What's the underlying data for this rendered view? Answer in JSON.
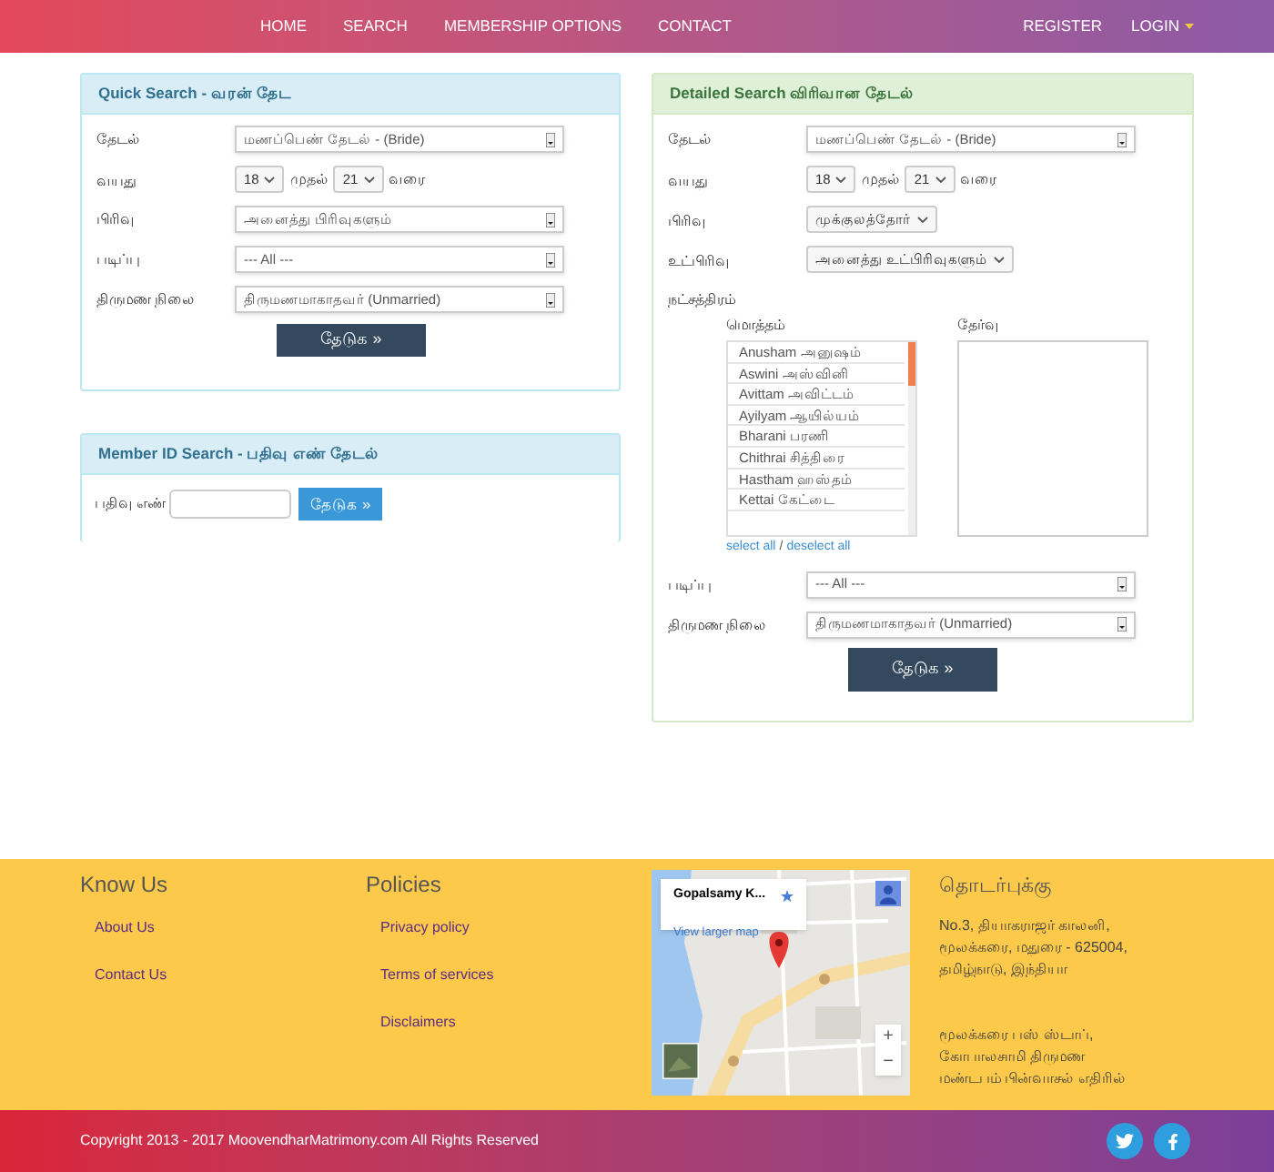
{
  "nav": {
    "left": [
      {
        "label": "HOME"
      },
      {
        "label": "SEARCH"
      },
      {
        "label": "MEMBERSHIP OPTIONS"
      },
      {
        "label": "CONTACT"
      }
    ],
    "right": [
      {
        "label": "REGISTER",
        "has_caret": false
      },
      {
        "label": "LOGIN",
        "has_caret": true
      }
    ]
  },
  "quick_search": {
    "title": "Quick Search - வரன் தேட",
    "fields": [
      {
        "kind": "select",
        "label": "தேடல்",
        "value": "மணப்பெண் தேடல் - (Bride)"
      },
      {
        "kind": "age",
        "label": "வயது",
        "from": "18",
        "from_word": "முதல்",
        "to": "21",
        "to_word": "வரை"
      },
      {
        "kind": "select",
        "label": "பிரிவு",
        "value": "அனைத்து பிரிவுகளும்"
      },
      {
        "kind": "select",
        "label": "படிப்பு",
        "value": "--- All ---"
      },
      {
        "kind": "select",
        "label": "திருமண நிலை",
        "value": "திருமணமாகாதவர் (Unmarried)"
      }
    ],
    "button": "தேடுக »"
  },
  "member_id_search": {
    "title": "Member ID Search - பதிவு எண் தேடல்",
    "label": "பதிவு எண்",
    "button": "தேடுக »"
  },
  "detailed_search": {
    "title": "Detailed Search விரிவான தேடல்",
    "fields": [
      {
        "kind": "select",
        "label": "தேடல்",
        "value": "மணப்பெண் தேடல் - (Bride)"
      },
      {
        "kind": "age",
        "label": "வயது",
        "from": "18",
        "from_word": "முதல்",
        "to": "21",
        "to_word": "வரை"
      },
      {
        "kind": "compact",
        "label": "பிரிவு",
        "value": "முக்குலத்தோர்"
      },
      {
        "kind": "compact",
        "label": "உட்பிரிவு",
        "value": "அனைத்து உட்பிரிவுகளும்"
      },
      {
        "kind": "stars",
        "label": "நட்சத்திரம்",
        "all_label": "மொத்தம்",
        "chosen_label": "தேர்வு",
        "options": [
          "Anusham அனுஷம்",
          "Aswini அஸ்வினி",
          "Avittam அவிட்டம்",
          "Ayilyam ஆயில்யம்",
          "Bharani பரணி",
          "Chithrai சித்திரை",
          "Hastham ஹஸ்தம்",
          "Kettai கேட்டை"
        ],
        "select_all": "select all",
        "separator": "/",
        "deselect_all": "deselect all"
      },
      {
        "kind": "select",
        "label": "படிப்பு",
        "value": "--- All ---"
      },
      {
        "kind": "select",
        "label": "திருமண நிலை",
        "value": "திருமணமாகாதவர் (Unmarried)"
      }
    ],
    "button": "தேடுக »"
  },
  "footer": {
    "know_us": {
      "title": "Know Us",
      "links": [
        "About Us",
        "Contact Us"
      ]
    },
    "policies": {
      "title": "Policies",
      "links": [
        "Privacy policy",
        "Terms of services",
        "Disclaimers"
      ]
    },
    "map": {
      "place": "Gopalsamy K...",
      "link": "View larger map",
      "zoom_in": "+",
      "zoom_out": "−"
    },
    "contact": {
      "title": "தொடர்புக்கு",
      "address": [
        "No.3, தியாகராஜர் காலனி,",
        "மூலக்கரை, மதுரை - 625004,",
        "தமிழ்நாடு, இந்தியா"
      ],
      "landmark": [
        "மூலக்கரை பஸ் ஸ்டாப்,",
        "கோபாலசாமி திருமண",
        "மண்டபம் பின்வாசல் எதிரில்"
      ]
    }
  },
  "copyright": "Copyright 2013 - 2017 MoovendharMatrimony.com All Rights Reserved"
}
